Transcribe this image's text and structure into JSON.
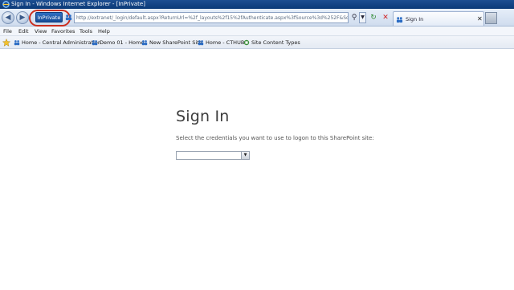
{
  "window": {
    "title": "Sign In - Windows Internet Explorer - [InPrivate]"
  },
  "nav": {
    "inprivate_label": "InPrivate",
    "address": "http://extranet/_login/default.aspx?ReturnUrl=%2f_layouts%2f15%2fAuthenticate.aspx%3fSource%3d%252F&Source=%",
    "refresh_glyph": "↻",
    "stop_glyph": "✕"
  },
  "tab": {
    "label": "Sign In",
    "close_glyph": "✕"
  },
  "menu": {
    "items": [
      "File",
      "Edit",
      "View",
      "Favorites",
      "Tools",
      "Help"
    ]
  },
  "favorites": {
    "items": [
      "Home - Central Administration",
      "Demo 01 - Home",
      "New SharePoint Site",
      "Home - CTHUB",
      "Site Content Types"
    ]
  },
  "page": {
    "title": "Sign In",
    "instruction": "Select the credentials you want to use to logon to this SharePoint site:",
    "credential_selected": ""
  },
  "colors": {
    "highlight_ring": "#cc2f1f",
    "title_bar": "#1d4f92"
  }
}
